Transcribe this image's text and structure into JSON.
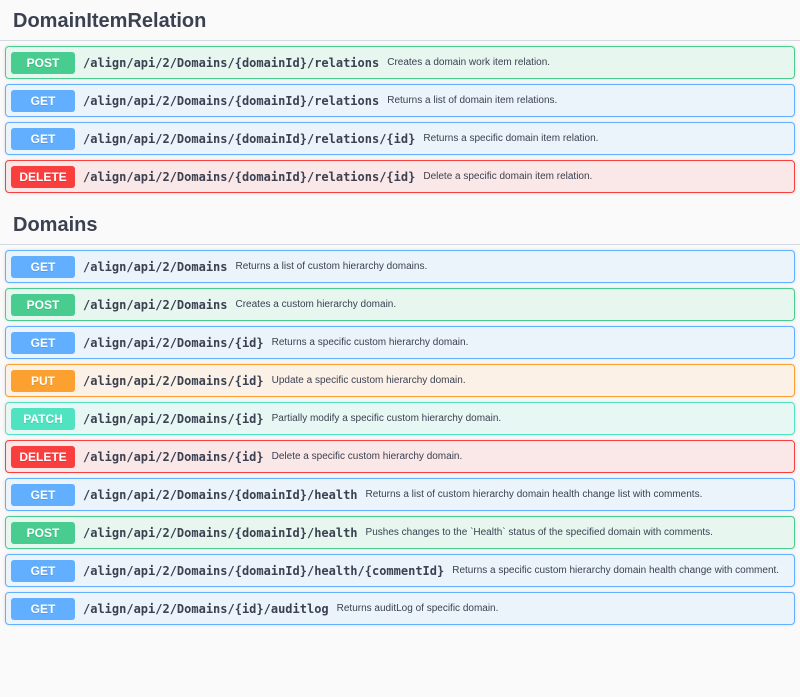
{
  "sections": [
    {
      "title": "DomainItemRelation",
      "operations": [
        {
          "method": "POST",
          "path": "/align/api/2/Domains/{domainId}/relations",
          "description": "Creates a domain work item relation."
        },
        {
          "method": "GET",
          "path": "/align/api/2/Domains/{domainId}/relations",
          "description": "Returns a list of domain item relations."
        },
        {
          "method": "GET",
          "path": "/align/api/2/Domains/{domainId}/relations/{id}",
          "description": "Returns a specific domain item relation."
        },
        {
          "method": "DELETE",
          "path": "/align/api/2/Domains/{domainId}/relations/{id}",
          "description": "Delete a specific domain item relation."
        }
      ]
    },
    {
      "title": "Domains",
      "operations": [
        {
          "method": "GET",
          "path": "/align/api/2/Domains",
          "description": "Returns a list of custom hierarchy domains."
        },
        {
          "method": "POST",
          "path": "/align/api/2/Domains",
          "description": "Creates a custom hierarchy domain."
        },
        {
          "method": "GET",
          "path": "/align/api/2/Domains/{id}",
          "description": "Returns a specific custom hierarchy domain."
        },
        {
          "method": "PUT",
          "path": "/align/api/2/Domains/{id}",
          "description": "Update a specific custom hierarchy domain."
        },
        {
          "method": "PATCH",
          "path": "/align/api/2/Domains/{id}",
          "description": "Partially modify a specific custom hierarchy domain."
        },
        {
          "method": "DELETE",
          "path": "/align/api/2/Domains/{id}",
          "description": "Delete a specific custom hierarchy domain."
        },
        {
          "method": "GET",
          "path": "/align/api/2/Domains/{domainId}/health",
          "description": "Returns a list of custom hierarchy domain health change list with comments."
        },
        {
          "method": "POST",
          "path": "/align/api/2/Domains/{domainId}/health",
          "description": "Pushes changes to the `Health` status of the specified domain with comments."
        },
        {
          "method": "GET",
          "path": "/align/api/2/Domains/{domainId}/health/{commentId}",
          "description": "Returns a specific custom hierarchy domain health change with comment."
        },
        {
          "method": "GET",
          "path": "/align/api/2/Domains/{id}/auditlog",
          "description": "Returns auditLog of specific domain."
        }
      ]
    }
  ],
  "colors": {
    "POST": "#49cc90",
    "GET": "#61affe",
    "DELETE": "#f93e3e",
    "PUT": "#fca130",
    "PATCH": "#50e3c2"
  }
}
